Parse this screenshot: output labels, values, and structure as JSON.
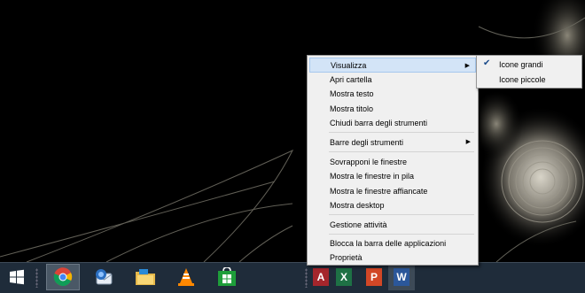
{
  "context_menu": {
    "items": [
      {
        "label": "Visualizza"
      },
      {
        "label": "Apri cartella"
      },
      {
        "label": "Mostra testo"
      },
      {
        "label": "Mostra titolo"
      },
      {
        "label": "Chiudi barra degli strumenti"
      },
      {
        "label": "Barre degli strumenti"
      },
      {
        "label": "Sovrapponi le finestre"
      },
      {
        "label": "Mostra le finestre in pila"
      },
      {
        "label": "Mostra le finestre affiancate"
      },
      {
        "label": "Mostra desktop"
      },
      {
        "label": "Gestione attività"
      },
      {
        "label": "Blocca la barra delle applicazioni"
      },
      {
        "label": "Proprietà"
      }
    ]
  },
  "submenu": {
    "items": [
      {
        "label": "Icone grandi",
        "checked": true
      },
      {
        "label": "Icone piccole",
        "checked": false
      }
    ]
  },
  "taskbar": {
    "icons": [
      "windows-start-icon",
      "chrome-icon",
      "thunderbird-icon",
      "file-explorer-icon",
      "vlc-icon",
      "windows-store-icon",
      "access-icon",
      "excel-icon",
      "powerpoint-icon",
      "word-icon"
    ],
    "toolbar_labels": {
      "access": "A",
      "excel": "X",
      "powerpoint": "P",
      "word": "W"
    }
  },
  "colors": {
    "taskbar": "#1f2c3a",
    "menu_bg": "#f0f0f0",
    "highlight": "#d3e4f7"
  }
}
